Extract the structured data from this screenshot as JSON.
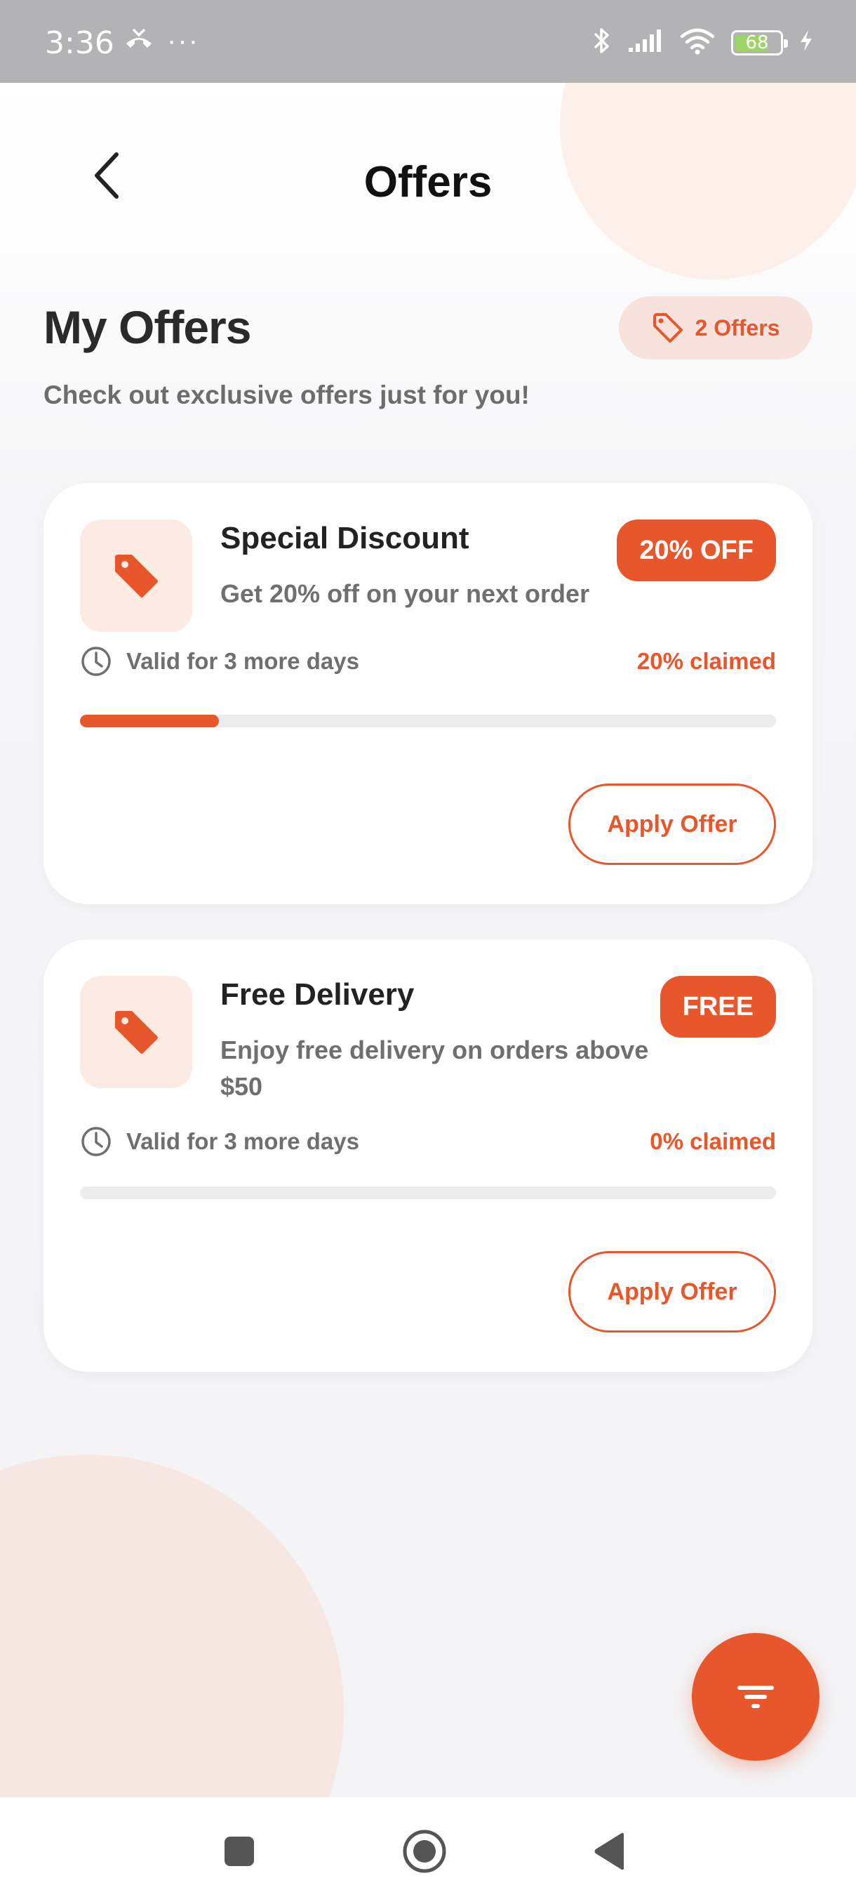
{
  "status_bar": {
    "time": "3:36",
    "more": "···",
    "battery": "68",
    "icons": [
      "missed-call-icon",
      "bluetooth-icon",
      "signal-icon",
      "wifi-icon",
      "battery-icon",
      "charging-icon"
    ]
  },
  "header": {
    "title": "Offers",
    "back_icon": "chevron-left-icon"
  },
  "section": {
    "title": "My Offers",
    "subtitle": "Check out exclusive offers just for you!",
    "count_label": "2 Offers",
    "count_icon": "tag-outline-icon"
  },
  "offers": [
    {
      "title": "Special Discount",
      "description": "Get 20% off on your next order",
      "badge": "20% OFF",
      "validity": "Valid for 3 more days",
      "claimed_label": "20% claimed",
      "claimed_fraction": 0.2,
      "button_label": "Apply Offer",
      "icon": "tag-icon"
    },
    {
      "title": "Free Delivery",
      "description": "Enjoy free delivery on orders above $50",
      "badge": "FREE",
      "validity": "Valid for 3 more days",
      "claimed_label": "0% claimed",
      "claimed_fraction": 0.0,
      "button_label": "Apply Offer",
      "icon": "tag-icon"
    }
  ],
  "fab": {
    "icon": "filter-icon"
  },
  "nav_bar": {
    "icons": [
      "recents-square-icon",
      "home-circle-icon",
      "back-triangle-icon"
    ]
  },
  "colors": {
    "accent": "#e8562b",
    "accent_soft": "#fbebe3",
    "status_bar": "#b3b3b5",
    "text_dark": "#222222",
    "text_muted": "#6f6f6f"
  }
}
